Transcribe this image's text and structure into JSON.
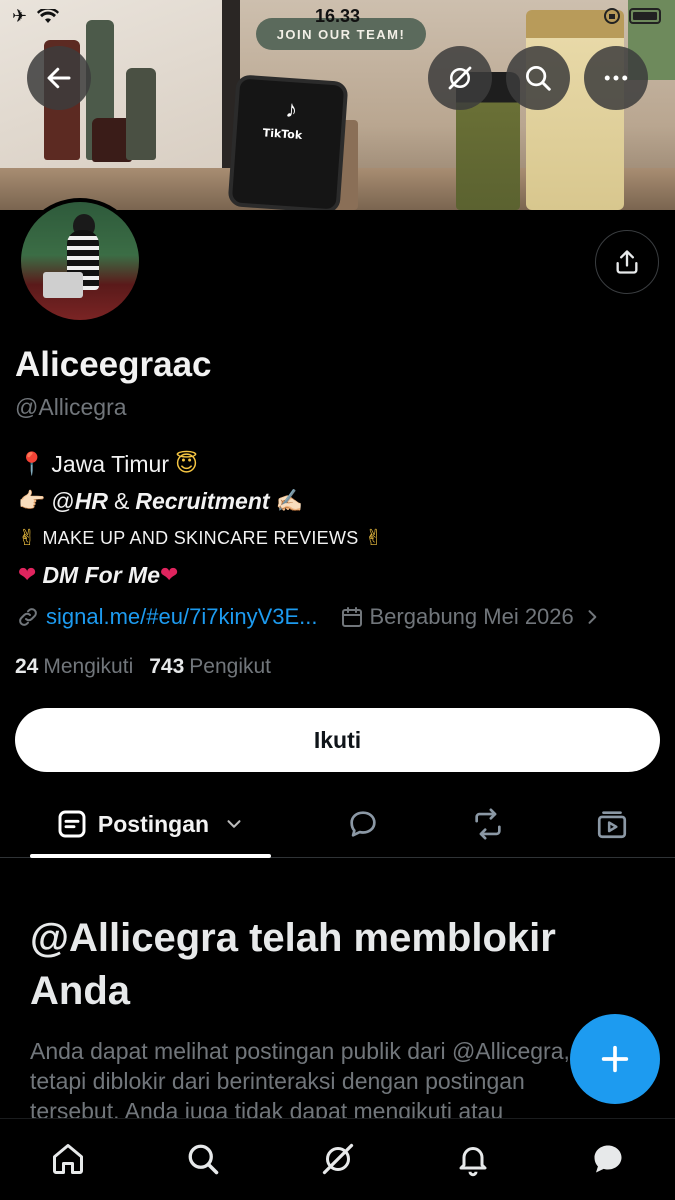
{
  "status_bar": {
    "time": "16.33"
  },
  "banner": {
    "join_label": "JOIN OUR TEAM!",
    "phone_brand": "TikTok"
  },
  "top_actions": [
    "back-arrow-icon",
    "grok-icon",
    "search-icon",
    "more-icon"
  ],
  "profile": {
    "display_name": "Aliceegraac",
    "handle": "@Allicegra",
    "bio": {
      "line1_emoji": "📍",
      "line1_text": "Jawa Timur",
      "line1_emoji_end": "😇",
      "line2_emoji": "👉🏻",
      "line2_at": "@",
      "line2_hr": "HR",
      "line2_amp": "&",
      "line2_recruit": "Recruitment",
      "line2_emoji_end": "✍🏻",
      "line3_emoji": "✌",
      "line3_text": "MAKE UP AND SKINCARE REVIEWS",
      "line3_emoji_end": "✌",
      "line4_emoji": "❤",
      "line4_text": "DM For Me",
      "line4_emoji_end": "❤"
    },
    "link": "signal.me/#eu/7i7kinyV3E...",
    "joined": "Bergabung Mei 2026",
    "following_count": "24",
    "following_label": "Mengikuti",
    "followers_count": "743",
    "followers_label": "Pengikut",
    "follow_button": "Ikuti"
  },
  "tabs": {
    "active_label": "Postingan"
  },
  "blocked": {
    "title": "@Allicegra telah memblokir Anda",
    "body": "Anda dapat melihat postingan publik dari @Allicegra, tetapi diblokir dari berinteraksi dengan postingan tersebut. Anda juga tidak dapat mengikuti atau"
  },
  "colors": {
    "accent": "#1d9bf0",
    "background": "#000000",
    "muted": "#71767b"
  }
}
